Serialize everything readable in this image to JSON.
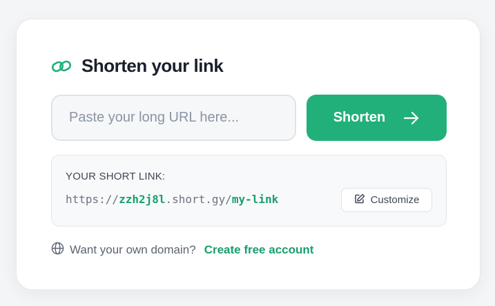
{
  "header": {
    "title": "Shorten your link",
    "icon": "link-icon"
  },
  "form": {
    "url_placeholder": "Paste your long URL here...",
    "url_value": "",
    "shorten_label": "Shorten",
    "shorten_icon": "arrow-right-icon"
  },
  "result": {
    "label": "YOUR SHORT LINK:",
    "url_prefix": "https://",
    "url_code": "zzh2j8l",
    "url_domain": ".short.gy/",
    "url_slug": "my-link",
    "customize_label": "Customize",
    "customize_icon": "edit-icon"
  },
  "footer": {
    "icon": "globe-icon",
    "prompt": "Want your own domain?",
    "link_label": "Create free account"
  },
  "colors": {
    "accent": "#22b07a",
    "accent_text": "#16a06b",
    "title": "#1a1f2b",
    "background": "#f4f5f7"
  }
}
